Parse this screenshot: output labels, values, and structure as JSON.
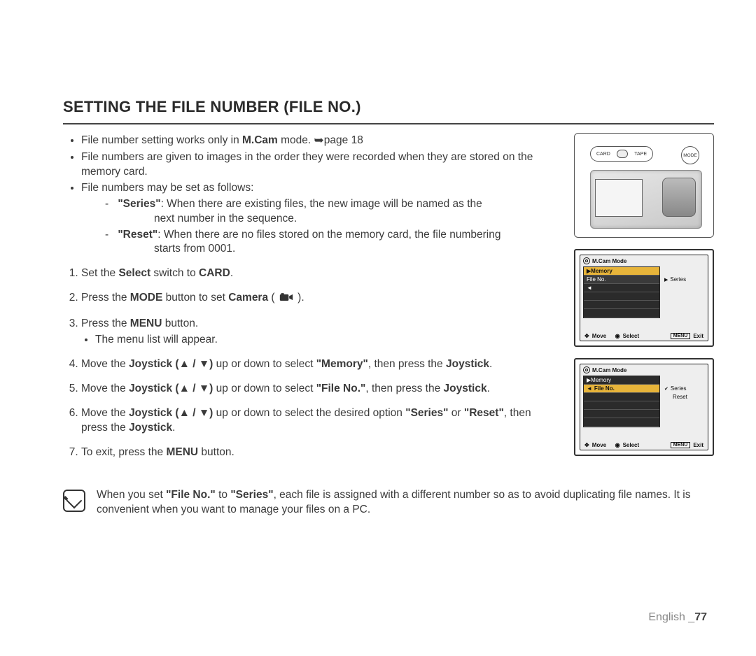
{
  "title": "SETTING THE FILE NUMBER (FILE NO.)",
  "bullets": {
    "b1a": "File number setting works only in ",
    "b1b": "M.Cam",
    "b1c": " mode. ",
    "b1d": "page 18",
    "b2": "File numbers are given to images in the order they were recorded when they are stored on the memory card.",
    "b3": "File numbers may be set as follows:",
    "s1_label": "\"Series\"",
    "s1_text": ": When there are existing files, the new image will be named as the",
    "s1_text2": "next number in the sequence.",
    "s2_label": "\"Reset\"",
    "s2_text": ": When there are no files stored on the memory card, the file numbering",
    "s2_text2": "starts from 0001."
  },
  "steps": {
    "s1a": "Set the ",
    "s1b": "Select",
    "s1c": " switch to ",
    "s1d": "CARD",
    "s1e": ".",
    "s2a": "Press the ",
    "s2b": "MODE",
    "s2c": " button to set ",
    "s2d": "Camera",
    "s2e": " ( ",
    "s2f": " ).",
    "s3a": "Press the ",
    "s3b": "MENU",
    "s3c": " button.",
    "s3sub": "The menu list will appear.",
    "s4a": "Move the ",
    "s4b": "Joystick (▲ / ▼)",
    "s4c": " up or down to select ",
    "s4d": "\"Memory\"",
    "s4e": ", then press the ",
    "s4f": "Joystick",
    "s4g": ".",
    "s5a": "Move the ",
    "s5b": "Joystick (▲ / ▼)",
    "s5c": " up or down to select ",
    "s5d": "\"File No.\"",
    "s5e": ", then press the ",
    "s5f": "Joystick",
    "s5g": ".",
    "s6a": "Move the ",
    "s6b": "Joystick (▲ / ▼)",
    "s6c": " up or down to select the desired option ",
    "s6d": "\"Series\"",
    "s6e": " or ",
    "s6f": "\"Reset\"",
    "s6g": ", then press the ",
    "s6h": "Joystick",
    "s6i": ".",
    "s7a": "To exit, press the ",
    "s7b": "MENU",
    "s7c": " button."
  },
  "note": {
    "a": "When you set ",
    "b": "\"File No.\"",
    "c": " to ",
    "d": "\"Series\"",
    "e": ", each file is assigned with a different number so as to avoid duplicating file names. It is convenient when you want to manage your files on a PC."
  },
  "figures": {
    "camera": {
      "card": "CARD",
      "tape": "TAPE",
      "mode": "MODE"
    },
    "menu1": {
      "header": "M.Cam Mode",
      "row_highlight": "▶Memory",
      "row2": "File No.",
      "side": "Series",
      "footer_move": "Move",
      "footer_select": "Select",
      "footer_menu": "MENU",
      "footer_exit": "Exit"
    },
    "menu2": {
      "header": "M.Cam Mode",
      "row1": "▶Memory",
      "row_highlight": "File No.",
      "side1": "Series",
      "side2": "Reset",
      "footer_move": "Move",
      "footer_select": "Select",
      "footer_menu": "MENU",
      "footer_exit": "Exit"
    }
  },
  "footer_lang": "English _",
  "footer_page": "77"
}
